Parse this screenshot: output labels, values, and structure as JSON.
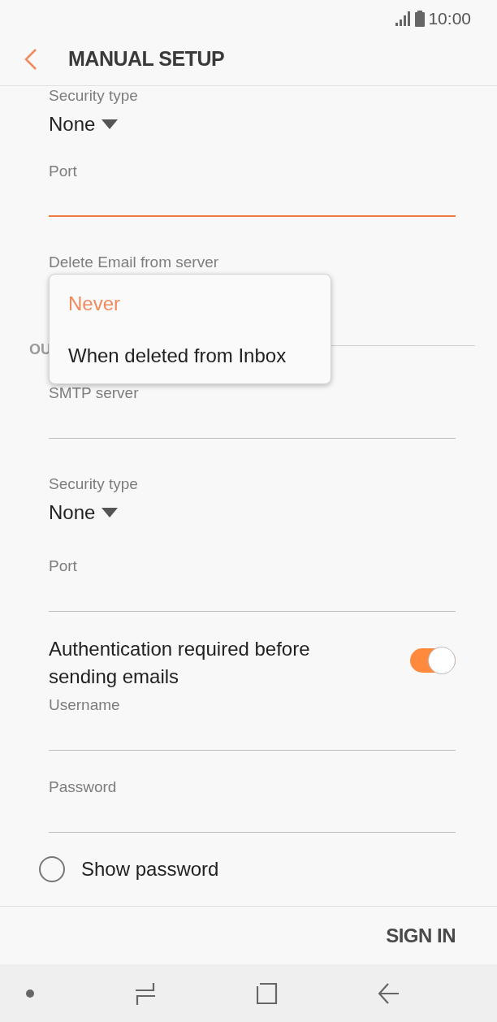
{
  "status_bar": {
    "time": "10:00"
  },
  "header": {
    "title": "MANUAL SETUP"
  },
  "items": [
    {
      "kind": "dropdown",
      "label": "Security type",
      "value": "None"
    },
    {
      "kind": "text",
      "label": "Port",
      "focused": true
    },
    {
      "kind": "label",
      "label": "Delete Email from server"
    },
    {
      "kind": "section",
      "label": "OU"
    },
    {
      "kind": "text",
      "label": "SMTP server",
      "focused": false
    },
    {
      "kind": "dropdown",
      "label": "Security type",
      "value": "None"
    },
    {
      "kind": "text",
      "label": "Port",
      "focused": false
    },
    {
      "kind": "switch",
      "label": "Authentication required before sending emails",
      "on": true
    },
    {
      "kind": "text",
      "label": "Username",
      "focused": false
    },
    {
      "kind": "text",
      "label": "Password",
      "focused": false
    },
    {
      "kind": "radio",
      "label": "Show password",
      "checked": false
    }
  ],
  "popup": {
    "options": [
      {
        "label": "Never",
        "selected": true
      },
      {
        "label": "When deleted from Inbox",
        "selected": false
      }
    ]
  },
  "footer": {
    "button": "SIGN IN"
  }
}
